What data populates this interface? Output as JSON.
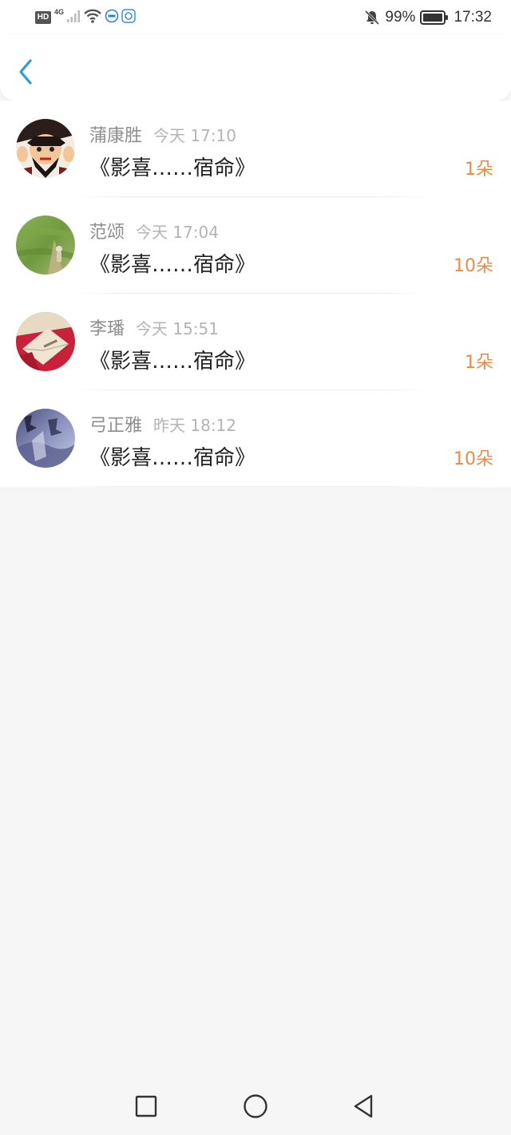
{
  "status_bar": {
    "hd": "HD",
    "network": "4G",
    "battery": "99%",
    "time": "17:32"
  },
  "header": {
    "back_icon": "chevron-left-icon",
    "accent_color": "#2a9be8"
  },
  "items": [
    {
      "name": "蒲康胜",
      "time": "今天 17:10",
      "title": "《影喜……宿命》",
      "count": "1朵"
    },
    {
      "name": "范颂",
      "time": "今天 17:04",
      "title": "《影喜……宿命》",
      "count": "10朵"
    },
    {
      "name": "李璠",
      "time": "今天 15:51",
      "title": "《影喜……宿命》",
      "count": "1朵"
    },
    {
      "name": "弓正雅",
      "time": "昨天 18:12",
      "title": "《影喜……宿命》",
      "count": "10朵"
    }
  ],
  "nav": {
    "square_icon": "recent-apps-icon",
    "circle_icon": "home-icon",
    "triangle_icon": "back-nav-icon"
  },
  "colors": {
    "count": "#e88b45",
    "name": "#8e8e8e",
    "time": "#b4b4b4",
    "background": "#f7f6f7"
  }
}
